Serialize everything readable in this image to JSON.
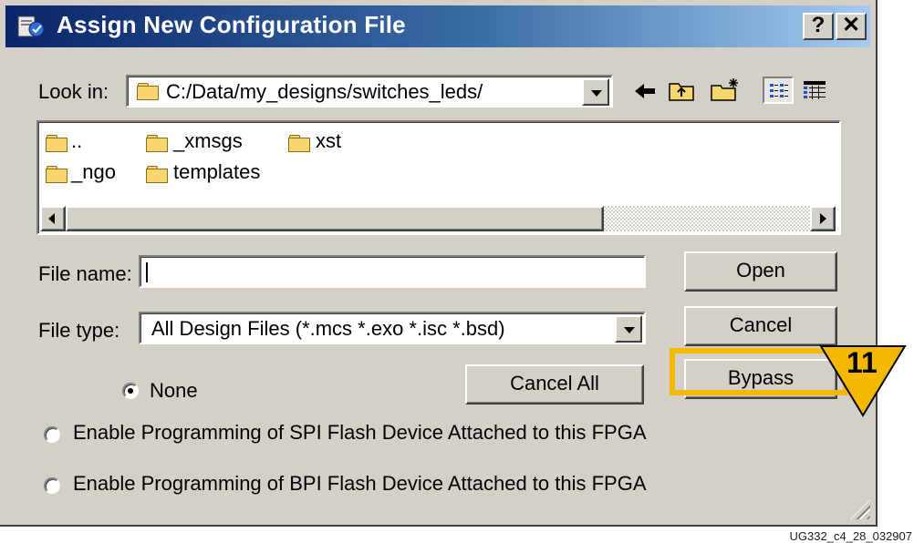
{
  "window": {
    "title": "Assign New Configuration File",
    "help_label": "?",
    "close_label": "✕",
    "title_icon": "config-file-icon"
  },
  "look_in": {
    "label": "Look in:",
    "path": "C:/Data/my_designs/switches_leds/",
    "toolbar_icons": [
      "back-arrow-icon",
      "up-folder-icon",
      "new-folder-icon",
      "list-view-icon",
      "details-view-icon"
    ]
  },
  "files": [
    {
      "name": ".."
    },
    {
      "name": "_xmsgs"
    },
    {
      "name": "xst"
    },
    {
      "name": "_ngo"
    },
    {
      "name": "templates"
    }
  ],
  "file_name": {
    "label": "File name:",
    "value": ""
  },
  "file_type": {
    "label": "File type:",
    "value": "All Design Files (*.mcs *.exo *.isc *.bsd)"
  },
  "buttons": {
    "open": "Open",
    "cancel": "Cancel",
    "bypass": "Bypass",
    "cancel_all": "Cancel All"
  },
  "options": {
    "none": "None",
    "spi": "Enable Programming of SPI Flash Device Attached to this FPGA",
    "bpi": "Enable Programming of BPI Flash Device Attached to this FPGA",
    "selected": "none"
  },
  "callout": {
    "number": "11",
    "color": "#f5b800"
  },
  "figure_id": "UG332_c4_28_032907"
}
